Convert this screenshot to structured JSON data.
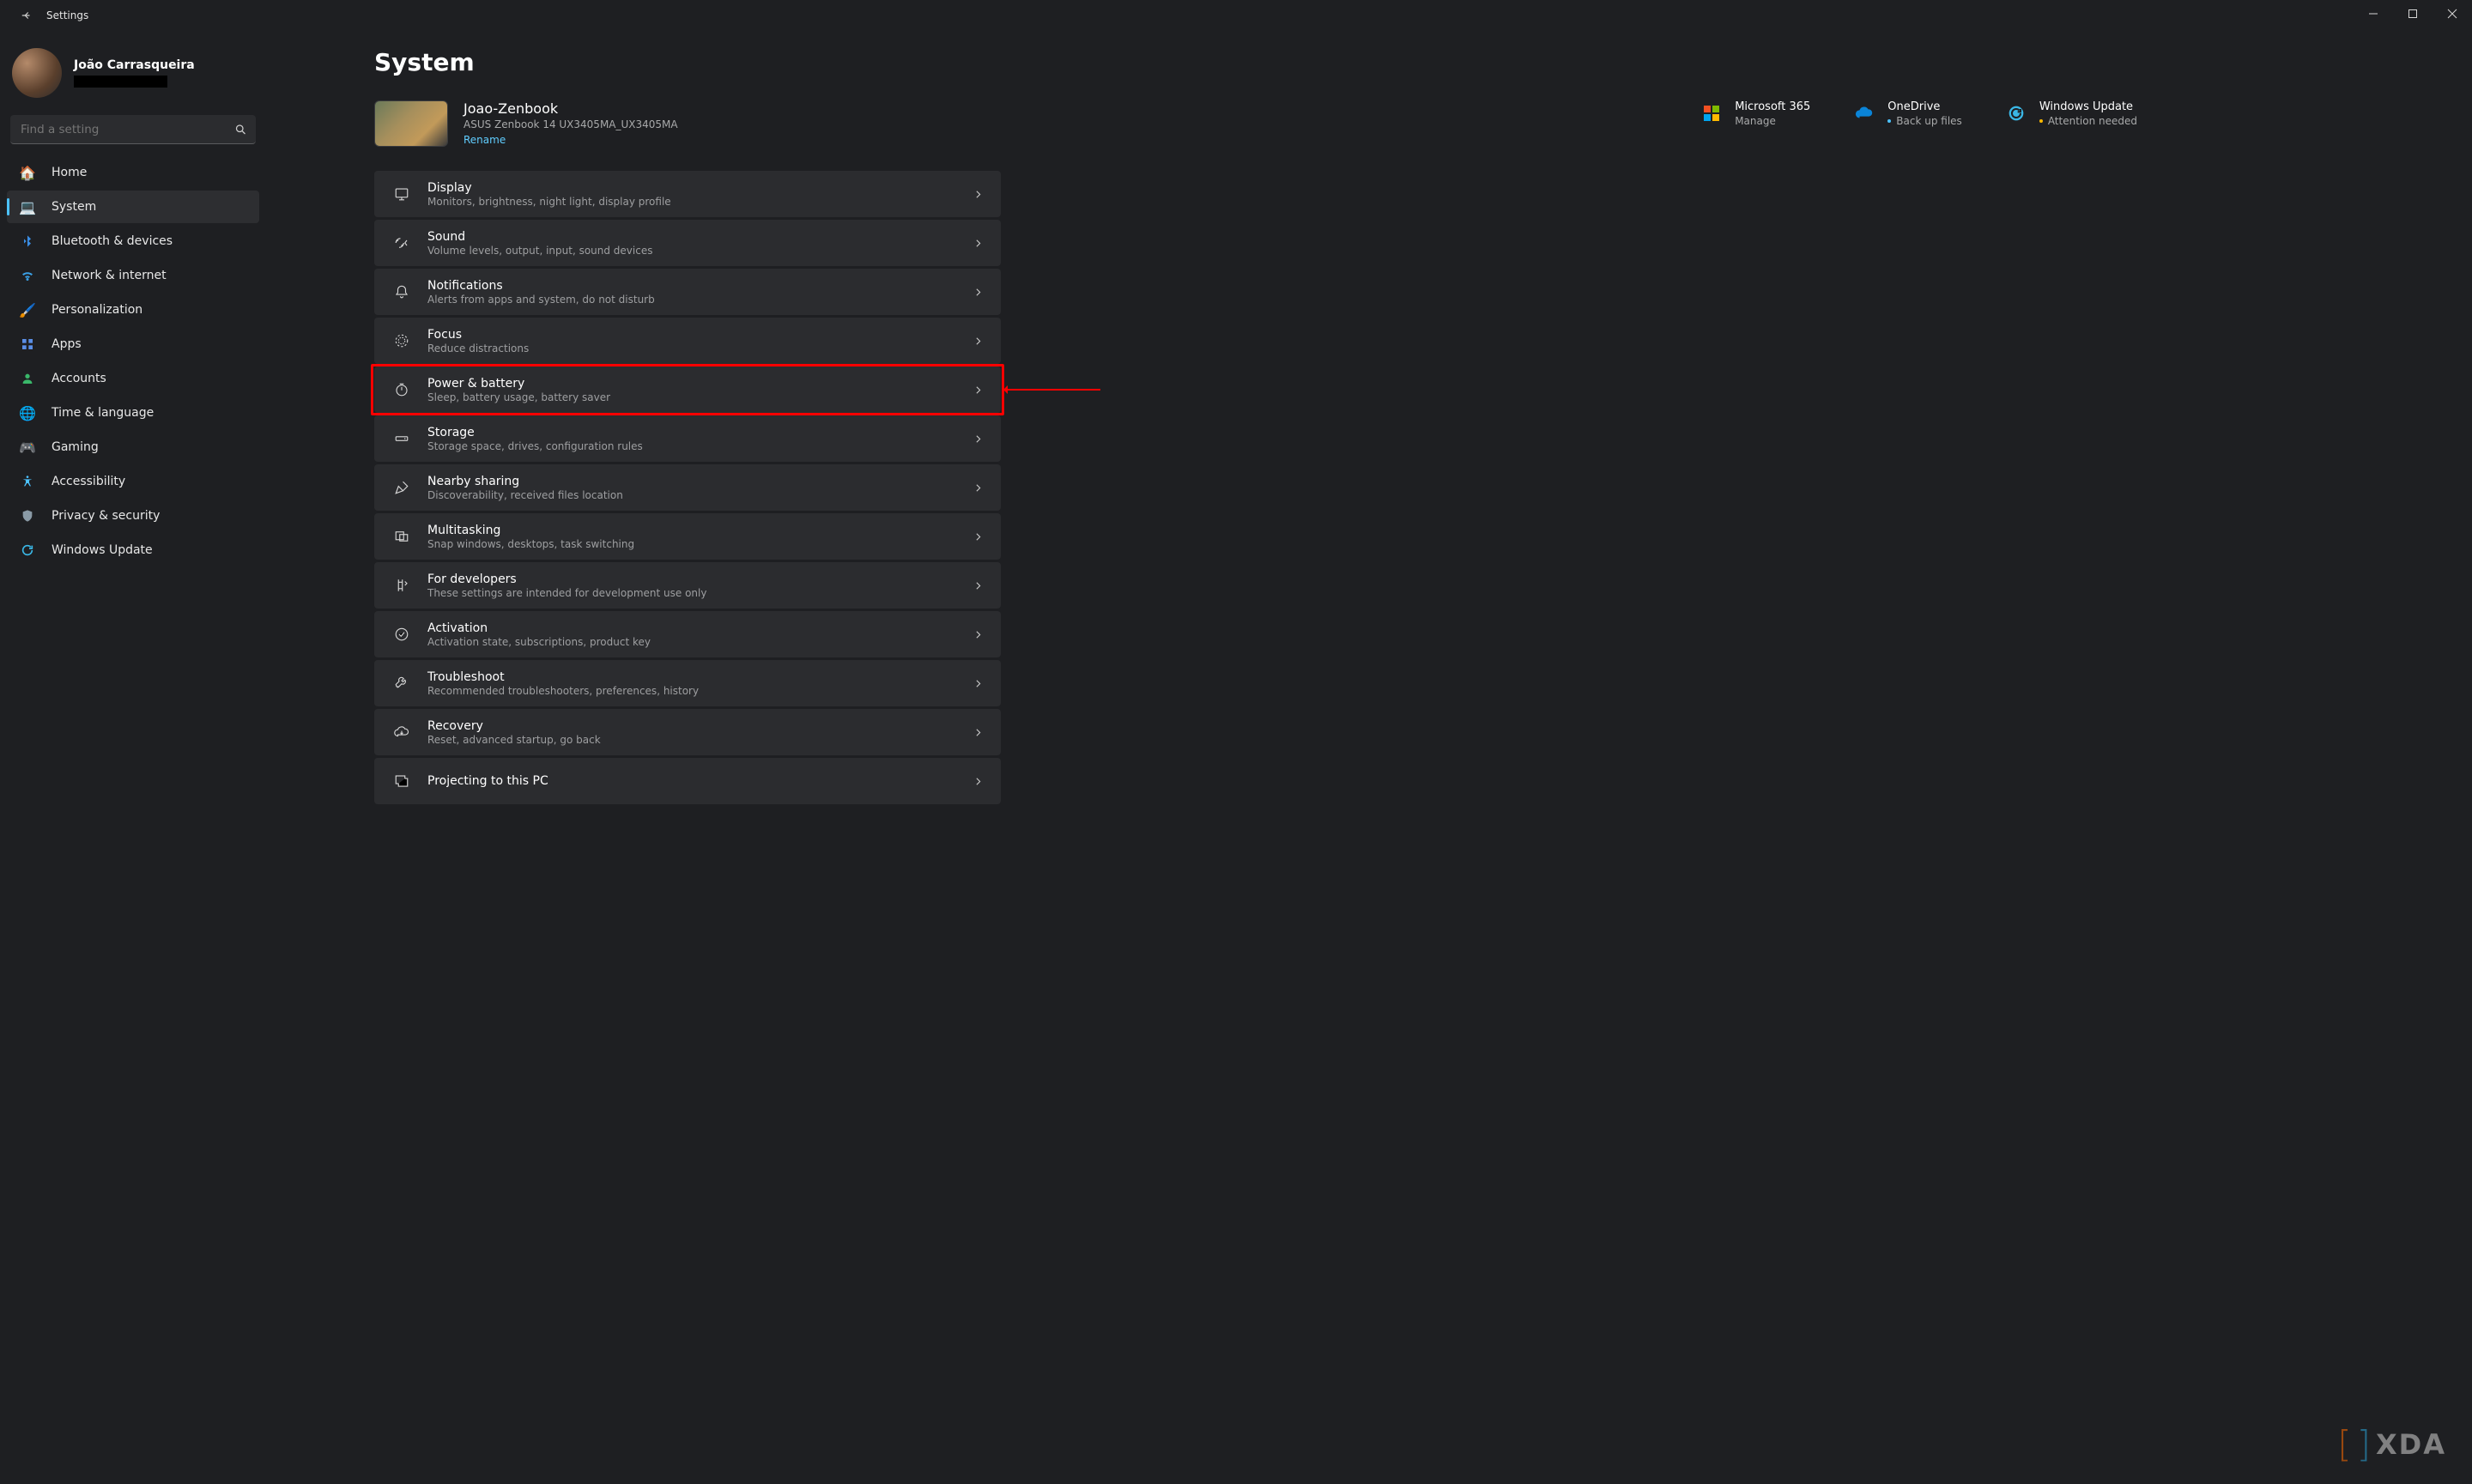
{
  "window": {
    "title": "Settings"
  },
  "profile": {
    "name": "João Carrasqueira",
    "email_redacted": true
  },
  "search": {
    "placeholder": "Find a setting"
  },
  "sidebar": {
    "items": [
      {
        "label": "Home"
      },
      {
        "label": "System"
      },
      {
        "label": "Bluetooth & devices"
      },
      {
        "label": "Network & internet"
      },
      {
        "label": "Personalization"
      },
      {
        "label": "Apps"
      },
      {
        "label": "Accounts"
      },
      {
        "label": "Time & language"
      },
      {
        "label": "Gaming"
      },
      {
        "label": "Accessibility"
      },
      {
        "label": "Privacy & security"
      },
      {
        "label": "Windows Update"
      }
    ],
    "selected_index": 1
  },
  "page": {
    "title": "System"
  },
  "device": {
    "name": "Joao-Zenbook",
    "model": "ASUS Zenbook 14 UX3405MA_UX3405MA",
    "rename_label": "Rename"
  },
  "status": {
    "microsoft365": {
      "label": "Microsoft 365",
      "sub": "Manage"
    },
    "onedrive": {
      "label": "OneDrive",
      "sub": "Back up files"
    },
    "update": {
      "label": "Windows Update",
      "sub": "Attention needed"
    }
  },
  "settings": [
    {
      "title": "Display",
      "sub": "Monitors, brightness, night light, display profile"
    },
    {
      "title": "Sound",
      "sub": "Volume levels, output, input, sound devices"
    },
    {
      "title": "Notifications",
      "sub": "Alerts from apps and system, do not disturb"
    },
    {
      "title": "Focus",
      "sub": "Reduce distractions"
    },
    {
      "title": "Power & battery",
      "sub": "Sleep, battery usage, battery saver"
    },
    {
      "title": "Storage",
      "sub": "Storage space, drives, configuration rules"
    },
    {
      "title": "Nearby sharing",
      "sub": "Discoverability, received files location"
    },
    {
      "title": "Multitasking",
      "sub": "Snap windows, desktops, task switching"
    },
    {
      "title": "For developers",
      "sub": "These settings are intended for development use only"
    },
    {
      "title": "Activation",
      "sub": "Activation state, subscriptions, product key"
    },
    {
      "title": "Troubleshoot",
      "sub": "Recommended troubleshooters, preferences, history"
    },
    {
      "title": "Recovery",
      "sub": "Reset, advanced startup, go back"
    },
    {
      "title": "Projecting to this PC",
      "sub": ""
    }
  ],
  "highlighted_index": 4,
  "watermark": {
    "text": "XDA"
  }
}
